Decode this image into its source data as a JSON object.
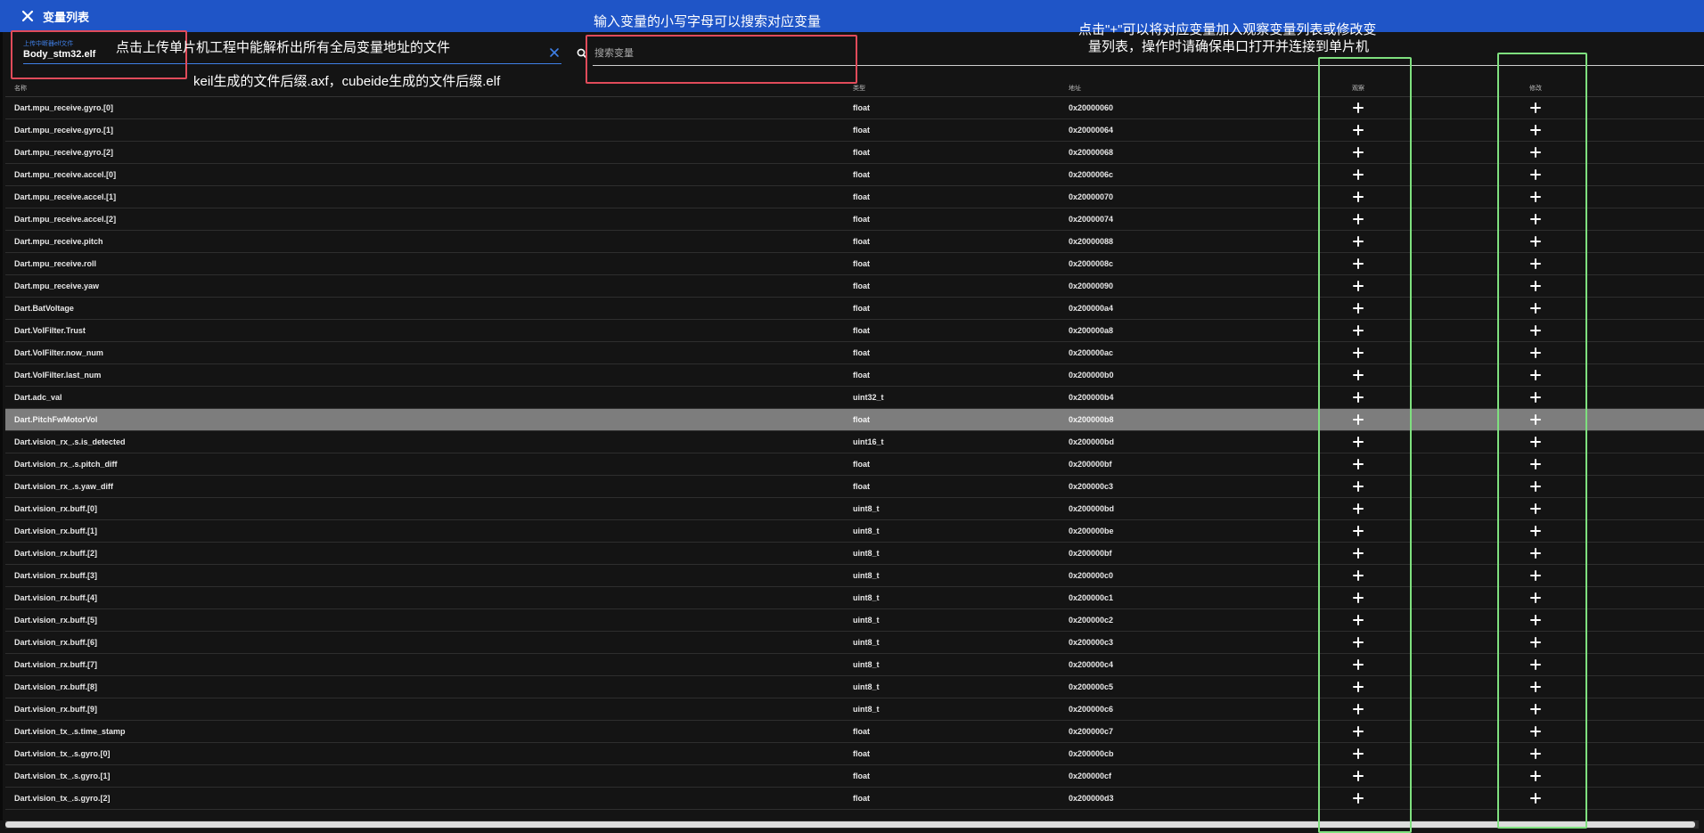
{
  "dialog": {
    "title": "变量列表",
    "file_field": {
      "label": "上传中断器elf文件",
      "value": "Body_stm32.elf"
    },
    "search": {
      "placeholder": "搜索变量",
      "value": ""
    }
  },
  "table": {
    "columns": {
      "name": "名称",
      "type": "类型",
      "address": "地址",
      "observe": "观察",
      "modify": "修改"
    },
    "selected_index": 14,
    "rows": [
      {
        "name": "Dart.mpu_receive.gyro.[0]",
        "type": "float",
        "address": "0x20000060"
      },
      {
        "name": "Dart.mpu_receive.gyro.[1]",
        "type": "float",
        "address": "0x20000064"
      },
      {
        "name": "Dart.mpu_receive.gyro.[2]",
        "type": "float",
        "address": "0x20000068"
      },
      {
        "name": "Dart.mpu_receive.accel.[0]",
        "type": "float",
        "address": "0x2000006c"
      },
      {
        "name": "Dart.mpu_receive.accel.[1]",
        "type": "float",
        "address": "0x20000070"
      },
      {
        "name": "Dart.mpu_receive.accel.[2]",
        "type": "float",
        "address": "0x20000074"
      },
      {
        "name": "Dart.mpu_receive.pitch",
        "type": "float",
        "address": "0x20000088"
      },
      {
        "name": "Dart.mpu_receive.roll",
        "type": "float",
        "address": "0x2000008c"
      },
      {
        "name": "Dart.mpu_receive.yaw",
        "type": "float",
        "address": "0x20000090"
      },
      {
        "name": "Dart.BatVoltage",
        "type": "float",
        "address": "0x200000a4"
      },
      {
        "name": "Dart.VolFilter.Trust",
        "type": "float",
        "address": "0x200000a8"
      },
      {
        "name": "Dart.VolFilter.now_num",
        "type": "float",
        "address": "0x200000ac"
      },
      {
        "name": "Dart.VolFilter.last_num",
        "type": "float",
        "address": "0x200000b0"
      },
      {
        "name": "Dart.adc_val",
        "type": "uint32_t",
        "address": "0x200000b4"
      },
      {
        "name": "Dart.PitchFwMotorVol",
        "type": "float",
        "address": "0x200000b8"
      },
      {
        "name": "Dart.vision_rx_.s.is_detected",
        "type": "uint16_t",
        "address": "0x200000bd"
      },
      {
        "name": "Dart.vision_rx_.s.pitch_diff",
        "type": "float",
        "address": "0x200000bf"
      },
      {
        "name": "Dart.vision_rx_.s.yaw_diff",
        "type": "float",
        "address": "0x200000c3"
      },
      {
        "name": "Dart.vision_rx.buff.[0]",
        "type": "uint8_t",
        "address": "0x200000bd"
      },
      {
        "name": "Dart.vision_rx.buff.[1]",
        "type": "uint8_t",
        "address": "0x200000be"
      },
      {
        "name": "Dart.vision_rx.buff.[2]",
        "type": "uint8_t",
        "address": "0x200000bf"
      },
      {
        "name": "Dart.vision_rx.buff.[3]",
        "type": "uint8_t",
        "address": "0x200000c0"
      },
      {
        "name": "Dart.vision_rx.buff.[4]",
        "type": "uint8_t",
        "address": "0x200000c1"
      },
      {
        "name": "Dart.vision_rx.buff.[5]",
        "type": "uint8_t",
        "address": "0x200000c2"
      },
      {
        "name": "Dart.vision_rx.buff.[6]",
        "type": "uint8_t",
        "address": "0x200000c3"
      },
      {
        "name": "Dart.vision_rx.buff.[7]",
        "type": "uint8_t",
        "address": "0x200000c4"
      },
      {
        "name": "Dart.vision_rx.buff.[8]",
        "type": "uint8_t",
        "address": "0x200000c5"
      },
      {
        "name": "Dart.vision_rx.buff.[9]",
        "type": "uint8_t",
        "address": "0x200000c6"
      },
      {
        "name": "Dart.vision_tx_.s.time_stamp",
        "type": "float",
        "address": "0x200000c7"
      },
      {
        "name": "Dart.vision_tx_.s.gyro.[0]",
        "type": "float",
        "address": "0x200000cb"
      },
      {
        "name": "Dart.vision_tx_.s.gyro.[1]",
        "type": "float",
        "address": "0x200000cf"
      },
      {
        "name": "Dart.vision_tx_.s.gyro.[2]",
        "type": "float",
        "address": "0x200000d3"
      }
    ]
  },
  "annotations": {
    "search_hint": "输入变量的小写字母可以搜索对应变量",
    "upload_hint": "点击上传单片机工程中能解析出所有全局变量地址的文件",
    "ext_hint": "keil生成的文件后缀.axf，cubeide生成的文件后缀.elf",
    "plus_hint_line1": "点击\"+\"可以将对应变量加入观察变量列表或修改变",
    "plus_hint_line2": "量列表，操作时请确保串口打开并连接到单片机"
  },
  "colors": {
    "header_bar": "#1f55c7",
    "annotation_red": "#e04b5a",
    "annotation_green": "#7fe07f",
    "selected_row": "#7d7d7d"
  },
  "icons": {
    "close": "close-icon",
    "clear": "clear-icon",
    "search": "search-icon",
    "add": "plus-icon"
  }
}
